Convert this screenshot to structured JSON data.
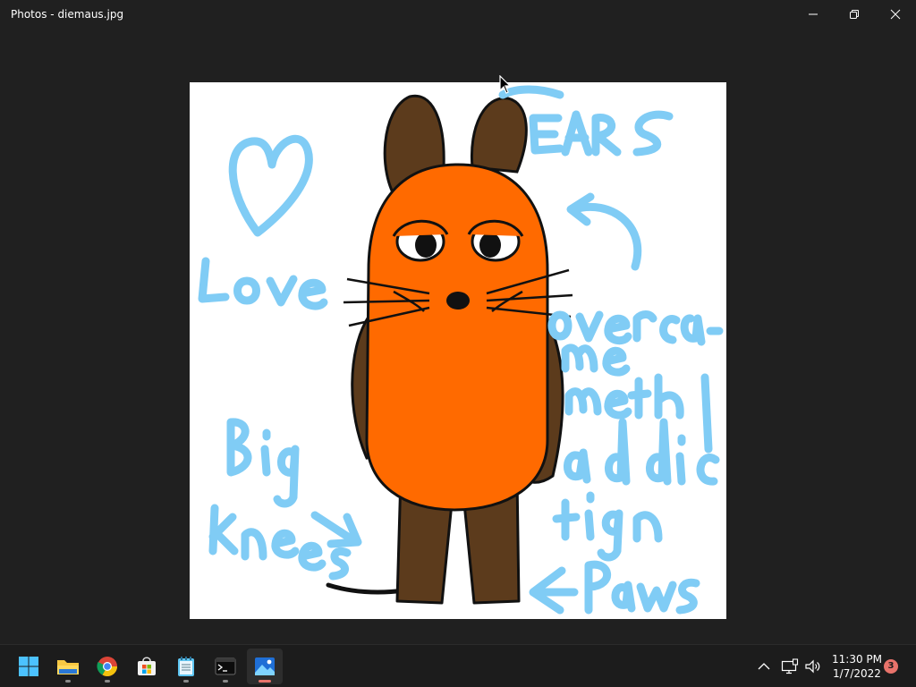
{
  "window": {
    "title": "Photos - diemaus.jpg",
    "controls": {
      "minimize": "minimize-icon",
      "maximize": "restore-icon",
      "close": "close-icon"
    }
  },
  "photo": {
    "file": "diemaus.jpg",
    "annotations": [
      "EARS",
      "Love",
      "overcame meth addiction",
      "Big knees",
      "Paws"
    ]
  },
  "taskbar": {
    "apps": [
      {
        "name": "Start",
        "icon": "windows-start-icon"
      },
      {
        "name": "File Explorer",
        "icon": "folder-icon"
      },
      {
        "name": "Google Chrome",
        "icon": "chrome-icon"
      },
      {
        "name": "Microsoft Store",
        "icon": "store-icon"
      },
      {
        "name": "Notepad",
        "icon": "notepad-icon"
      },
      {
        "name": "Terminal",
        "icon": "terminal-icon"
      },
      {
        "name": "Photos",
        "icon": "photos-icon",
        "active": true
      }
    ],
    "tray": {
      "icons": [
        "chevron-up-icon",
        "network-icon",
        "volume-icon"
      ],
      "time": "11:30 PM",
      "date": "1/7/2022",
      "notification_count": "3"
    }
  },
  "colors": {
    "background": "#202020",
    "taskbar": "#1c1c1c",
    "accent": "#e8736b",
    "mouse_orange": "#ff6a00",
    "mouse_brown": "#5c3b1c",
    "annotation_blue": "#80ccf5"
  }
}
